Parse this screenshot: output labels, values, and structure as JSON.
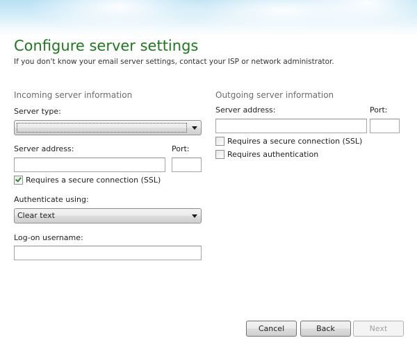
{
  "header": {
    "title": "Configure server settings",
    "subtitle": "If you don't know your email server settings, contact your ISP or network administrator."
  },
  "incoming": {
    "section_title": "Incoming server information",
    "server_type_label": "Server type:",
    "server_type_value": "",
    "server_address_label": "Server address:",
    "server_address_value": "",
    "port_label": "Port:",
    "port_value": "",
    "ssl_label": "Requires a secure connection (SSL)",
    "ssl_checked": true,
    "authenticate_label": "Authenticate using:",
    "authenticate_value": "Clear text",
    "logon_label": "Log-on username:",
    "logon_value": "                                              ."
  },
  "outgoing": {
    "section_title": "Outgoing server information",
    "server_address_label": "Server address:",
    "server_address_value": "",
    "port_label": "Port:",
    "port_value": "",
    "ssl_label": "Requires a secure connection (SSL)",
    "ssl_checked": false,
    "auth_label": "Requires authentication",
    "auth_checked": false
  },
  "buttons": {
    "cancel": "Cancel",
    "back": "Back",
    "next": "Next",
    "next_enabled": false
  },
  "colors": {
    "title": "#1c7a1c",
    "section": "#6b6b6b",
    "check": "#2c8a2c"
  }
}
